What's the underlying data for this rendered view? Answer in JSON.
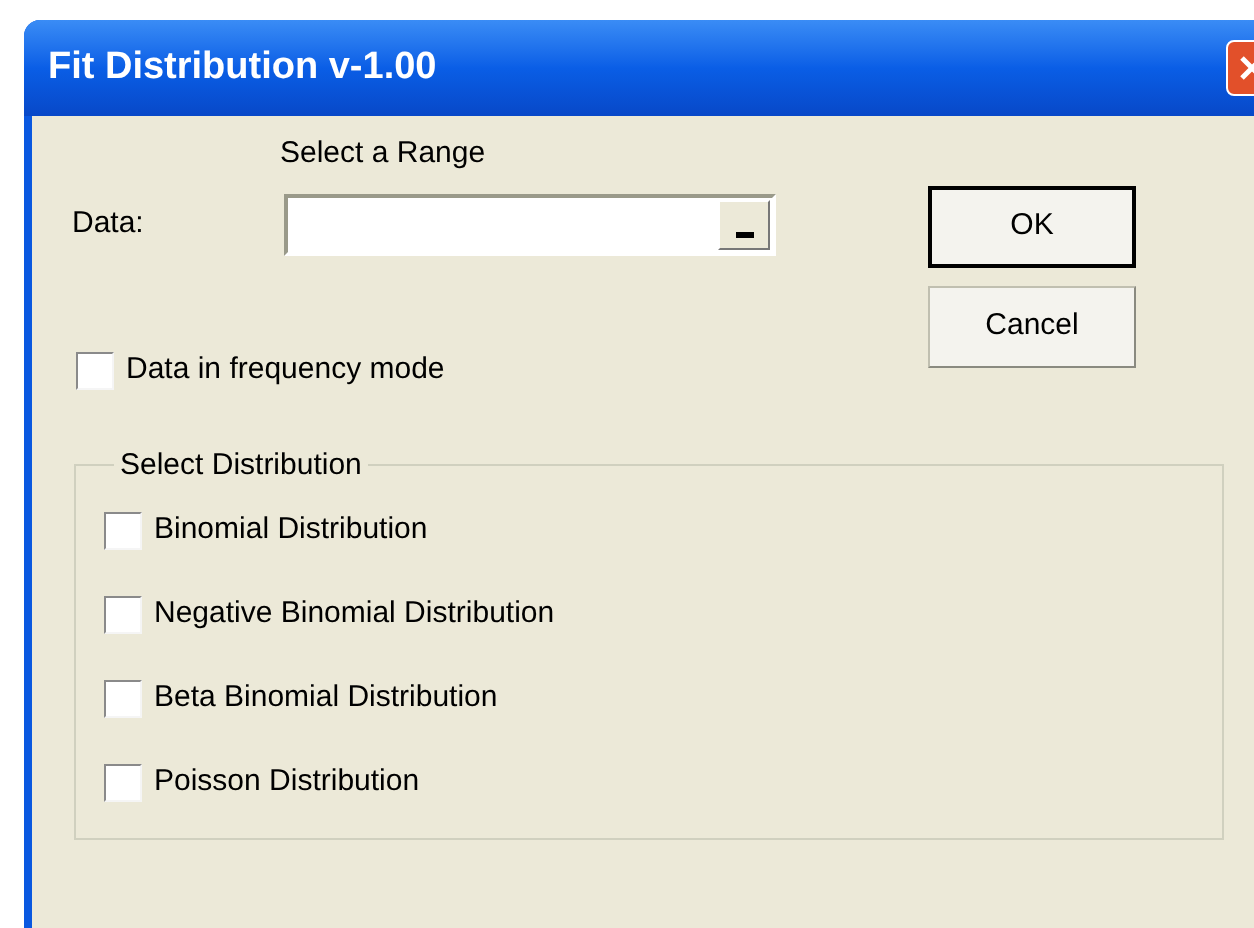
{
  "window": {
    "title": "Fit Distribution v-1.00"
  },
  "range_caption": "Select a Range",
  "data_field": {
    "label": "Data:"
  },
  "buttons": [
    "OK",
    "Cancel"
  ],
  "frequency_mode": {
    "label": "Data in frequency mode",
    "checked": false
  },
  "distribution_group": {
    "title": "Select Distribution",
    "options": [
      {
        "label": "Binomial Distribution",
        "checked": false
      },
      {
        "label": "Negative Binomial Distribution",
        "checked": false
      },
      {
        "label": "Beta Binomial Distribution",
        "checked": false
      },
      {
        "label": "Poisson Distribution",
        "checked": false
      }
    ]
  }
}
